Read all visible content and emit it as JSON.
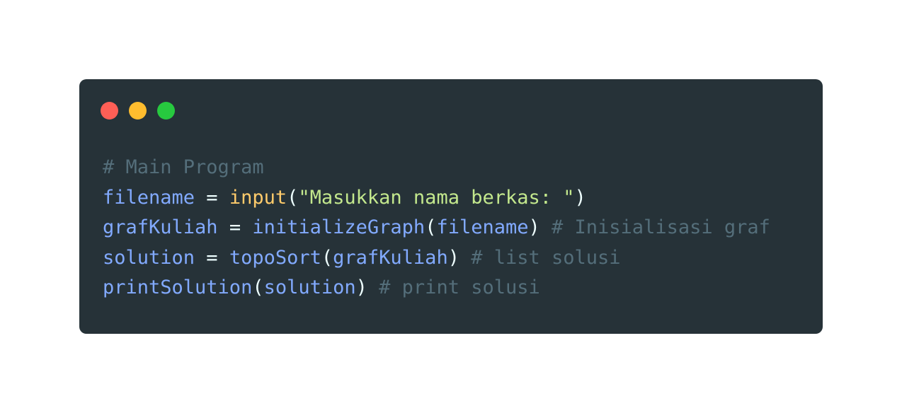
{
  "colors": {
    "page_background": "#ffffff",
    "window_background": "#263238",
    "dot_red": "#ff5f56",
    "dot_yellow": "#ffbd2e",
    "dot_green": "#27c93f",
    "comment": "#546e7a",
    "identifier": "#82aaff",
    "builtin": "#ffcb6b",
    "string": "#c3e88d",
    "default_text": "#eeffff"
  },
  "window_controls": [
    {
      "name": "close",
      "color_key": "dot_red"
    },
    {
      "name": "minimize",
      "color_key": "dot_yellow"
    },
    {
      "name": "maximize",
      "color_key": "dot_green"
    }
  ],
  "code": {
    "line1": {
      "comment": "# Main Program"
    },
    "line2": {
      "var": "filename",
      "eq": " = ",
      "builtin": "input",
      "open": "(",
      "string": "\"Masukkan nama berkas: \"",
      "close": ")"
    },
    "line3": {
      "var": "grafKuliah",
      "eq": " = ",
      "func": "initializeGraph",
      "open": "(",
      "arg": "filename",
      "close": ")",
      "comment": " # Inisialisasi graf"
    },
    "line4": {
      "var": "solution",
      "eq": " = ",
      "func": "topoSort",
      "open": "(",
      "arg": "grafKuliah",
      "close": ")",
      "comment": " # list solusi"
    },
    "line5": {
      "func": "printSolution",
      "open": "(",
      "arg": "solution",
      "close": ")",
      "comment": " # print solusi"
    }
  }
}
